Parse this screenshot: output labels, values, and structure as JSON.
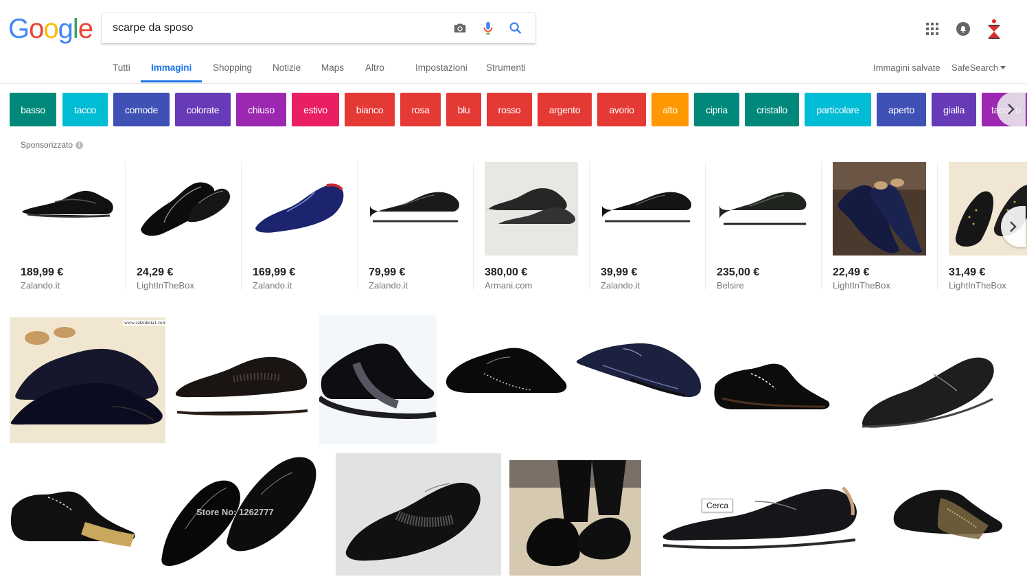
{
  "logo": {
    "letters": [
      "G",
      "o",
      "o",
      "g",
      "l",
      "e"
    ],
    "colors": [
      "#4285f4",
      "#ea4335",
      "#fbbc05",
      "#4285f4",
      "#34a853",
      "#ea4335"
    ]
  },
  "search": {
    "query": "scarpe da sposo",
    "camera_icon": "camera-icon",
    "mic_icon": "microphone-icon",
    "search_icon": "search-icon"
  },
  "header_icons": {
    "apps": "apps-grid-icon",
    "notifications": "notifications-bell-icon",
    "account": "account-avatar-icon"
  },
  "tabs": [
    {
      "label": "Tutti",
      "active": false
    },
    {
      "label": "Immagini",
      "active": true
    },
    {
      "label": "Shopping",
      "active": false
    },
    {
      "label": "Notizie",
      "active": false
    },
    {
      "label": "Maps",
      "active": false
    },
    {
      "label": "Altro",
      "active": false
    },
    {
      "label": "Impostazioni",
      "active": false
    },
    {
      "label": "Strumenti",
      "active": false
    }
  ],
  "right_links": {
    "saved": "Immagini salvate",
    "safesearch": "SafeSearch"
  },
  "chips": [
    {
      "label": "basso",
      "color": "#00897b"
    },
    {
      "label": "tacco",
      "color": "#00bcd4"
    },
    {
      "label": "comode",
      "color": "#3f51b5"
    },
    {
      "label": "colorate",
      "color": "#673ab7"
    },
    {
      "label": "chiuso",
      "color": "#9c27b0"
    },
    {
      "label": "estivo",
      "color": "#e91e63"
    },
    {
      "label": "bianco",
      "color": "#e53935"
    },
    {
      "label": "rosa",
      "color": "#e53935"
    },
    {
      "label": "blu",
      "color": "#e53935"
    },
    {
      "label": "rosso",
      "color": "#e53935"
    },
    {
      "label": "argento",
      "color": "#e53935"
    },
    {
      "label": "avorio",
      "color": "#e53935"
    },
    {
      "label": "alto",
      "color": "#ff9800"
    },
    {
      "label": "cipria",
      "color": "#00897b"
    },
    {
      "label": "cristallo",
      "color": "#00897b"
    },
    {
      "label": "particolare",
      "color": "#00bcd4"
    },
    {
      "label": "aperto",
      "color": "#3f51b5"
    },
    {
      "label": "gialla",
      "color": "#673ab7"
    },
    {
      "label": "tacco b",
      "color": "#9c27b0"
    }
  ],
  "sponsored_label": "Sponsorizzato",
  "products": [
    {
      "price": "189,99 €",
      "merchant": "Zalando.it"
    },
    {
      "price": "24,29 €",
      "merchant": "LightInTheBox"
    },
    {
      "price": "169,99 €",
      "merchant": "Zalando.it"
    },
    {
      "price": "79,99 €",
      "merchant": "Zalando.it"
    },
    {
      "price": "380,00 €",
      "merchant": "Armani.com"
    },
    {
      "price": "39,99 €",
      "merchant": "Zalando.it"
    },
    {
      "price": "235,00 €",
      "merchant": "Belsire"
    },
    {
      "price": "22,49 €",
      "merchant": "LightInTheBox"
    },
    {
      "price": "31,49 €",
      "merchant": "LightInTheBox"
    }
  ],
  "watermarks": {
    "calzoleria": "www.calzoleria1.com",
    "store": "Store No: 1262777"
  },
  "tooltip": "Cerca"
}
